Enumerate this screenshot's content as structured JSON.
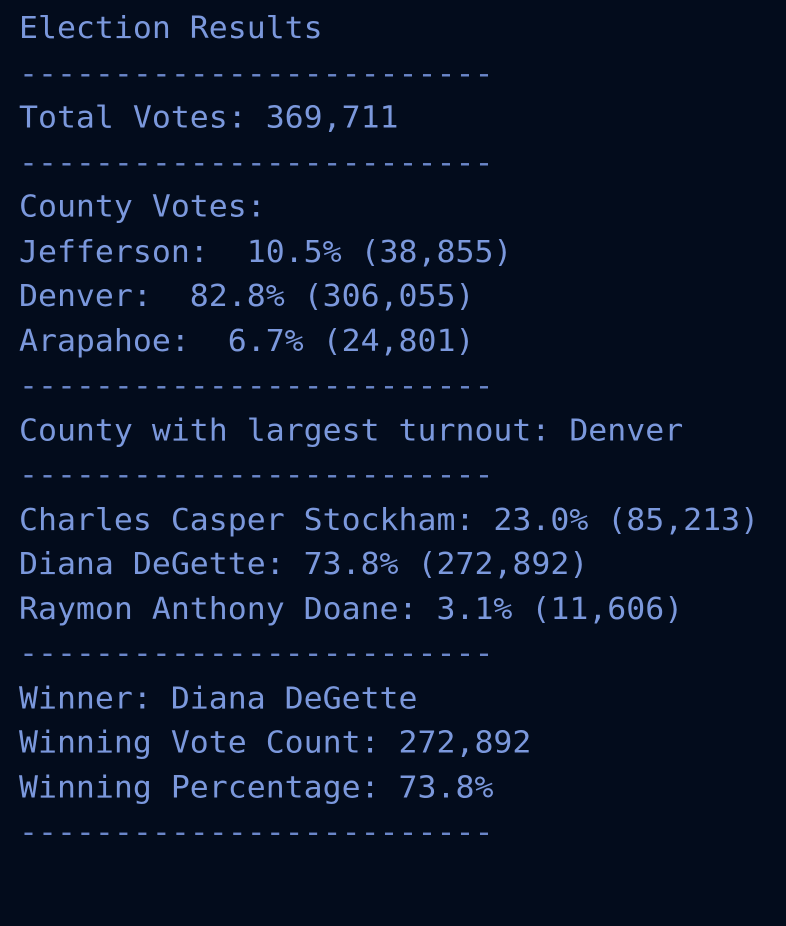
{
  "terminal": {
    "title": "Election Results",
    "divider": "-------------------------",
    "total_votes": "Total Votes: 369,711",
    "county_votes_heading": "County Votes:",
    "counties": [
      "Jefferson:  10.5% (38,855)",
      "Denver:  82.8% (306,055)",
      "Arapahoe:  6.7% (24,801)"
    ],
    "largest_county": "County with largest turnout: Denver",
    "candidates": [
      "Charles Casper Stockham: 23.0% (85,213)",
      "Diana DeGette: 73.8% (272,892)",
      "Raymon Anthony Doane: 3.1% (11,606)"
    ],
    "winner": "Winner: Diana DeGette",
    "winning_vote_count": "Winning Vote Count: 272,892",
    "winning_percentage": "Winning Percentage: 73.8%"
  },
  "colors": {
    "background": "#030c1c",
    "text": "#7b98dc"
  }
}
